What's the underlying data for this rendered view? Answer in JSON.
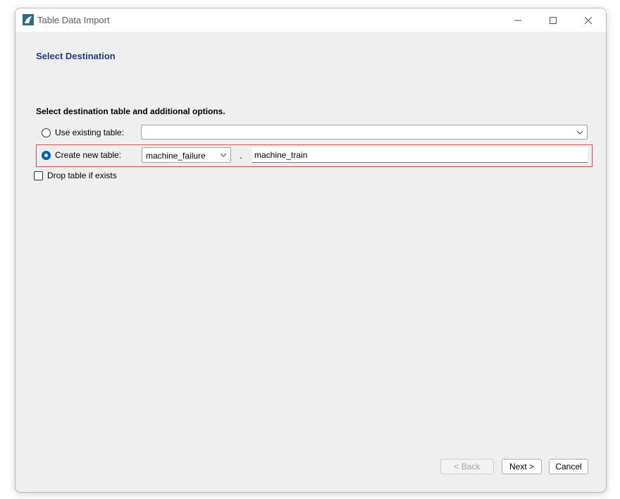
{
  "window": {
    "title": "Table Data Import",
    "app_icon": "mysql-dolphin-icon"
  },
  "page": {
    "section_title": "Select Destination",
    "instructions": "Select destination table and additional options."
  },
  "options": {
    "use_existing_label": "Use existing table:",
    "use_existing_selected": false,
    "use_existing_value": "",
    "create_new_label": "Create new table:",
    "create_new_selected": true,
    "schema_value": "machine_failure",
    "separator": ".",
    "table_name_value": "machine_train",
    "drop_table_label": "Drop table if exists",
    "drop_table_checked": false
  },
  "footer": {
    "back_label": "< Back",
    "next_label": "Next >",
    "cancel_label": "Cancel"
  },
  "colors": {
    "section_title": "#1f3d7a",
    "highlight_border": "#e0444a",
    "radio_accent": "#005fb8"
  }
}
